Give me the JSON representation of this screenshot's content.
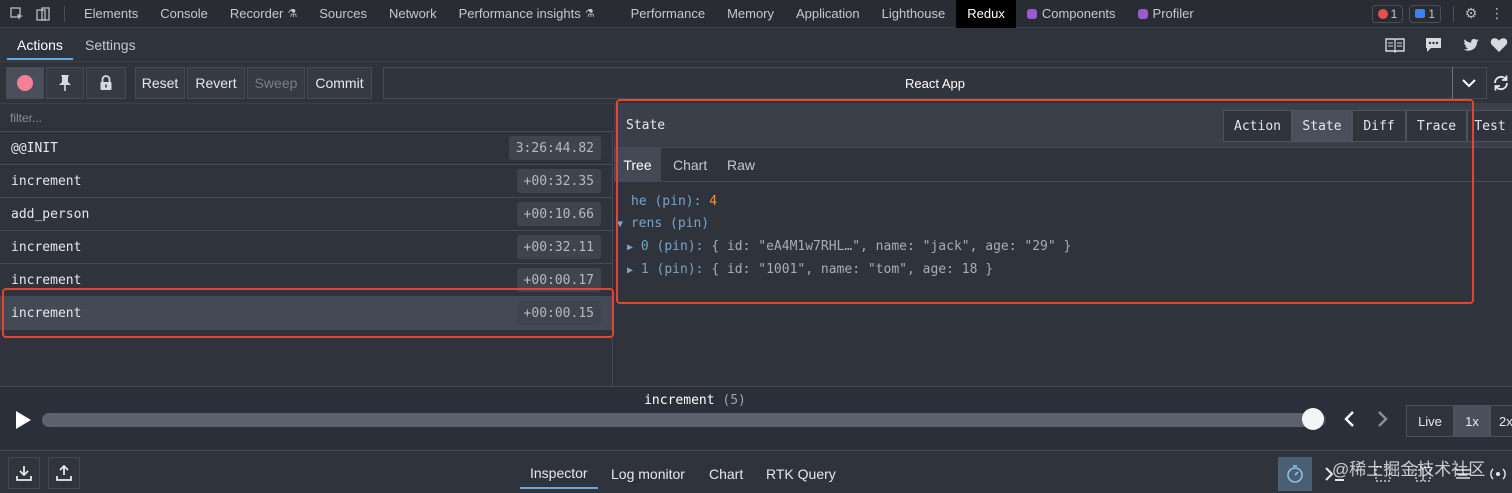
{
  "devtools": {
    "tabs": [
      "Elements",
      "Console",
      "Recorder",
      "Sources",
      "Network",
      "Performance insights",
      "Performance",
      "Memory",
      "Application",
      "Lighthouse",
      "Redux",
      "Components",
      "Profiler"
    ],
    "active_tab": "Redux",
    "error_count": "1",
    "message_count": "1"
  },
  "subtabs": {
    "actions": "Actions",
    "settings": "Settings"
  },
  "toolbar": {
    "reset": "Reset",
    "revert": "Revert",
    "sweep": "Sweep",
    "commit": "Commit",
    "instance": "React App"
  },
  "filter": {
    "placeholder": "filter..."
  },
  "actions": [
    {
      "name": "@@INIT",
      "time": "3:26:44.82"
    },
    {
      "name": "increment",
      "time": "+00:32.35"
    },
    {
      "name": "add_person",
      "time": "+00:10.66"
    },
    {
      "name": "increment",
      "time": "+00:32.11"
    },
    {
      "name": "increment",
      "time": "+00:00.17"
    },
    {
      "name": "increment",
      "time": "+00:00.15"
    }
  ],
  "state_panel": {
    "title": "State",
    "modes": [
      "Action",
      "State",
      "Diff",
      "Trace",
      "Test"
    ],
    "active_mode": "State",
    "views": [
      "Tree",
      "Chart",
      "Raw"
    ],
    "active_view": "Tree"
  },
  "tree": {
    "he_key": "he (pin):",
    "he_value": "4",
    "rens_key": "rens (pin)",
    "item0_key": "0 (pin):",
    "item0_value": "{ id: \"eA4M1w7RHL…\", name: \"jack\", age: \"29\" }",
    "item1_key": "1 (pin):",
    "item1_value": "{ id: \"1001\", name: \"tom\", age: 18 }"
  },
  "slider": {
    "label": "increment",
    "index": "(5)",
    "progress": 1.0,
    "live": "Live",
    "speed_1x": "1x",
    "speed_2x": "2x"
  },
  "monitors": [
    "Inspector",
    "Log monitor",
    "Chart",
    "RTK Query"
  ],
  "active_monitor": "Inspector",
  "watermark": "@稀土掘金技术社区",
  "colors": {
    "accent": "#6aa8d8",
    "highlight": "#e5452e",
    "record": "#f47f97"
  }
}
